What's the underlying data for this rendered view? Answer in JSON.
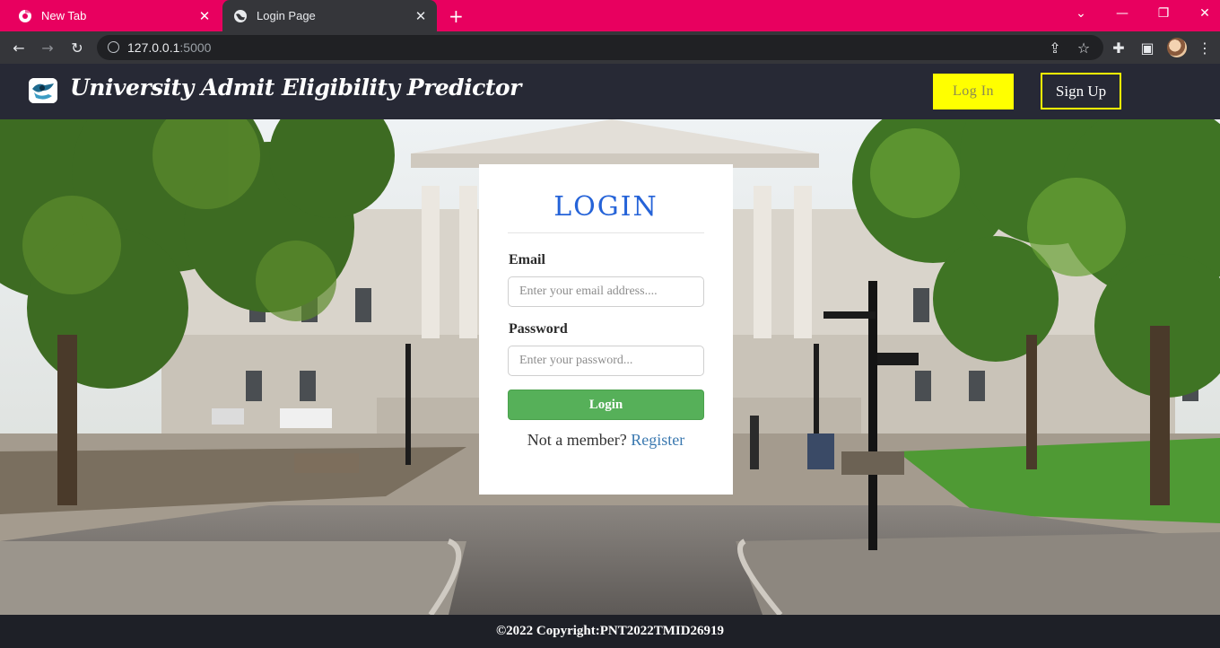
{
  "browser": {
    "tabs": [
      {
        "title": "New Tab",
        "active": false
      },
      {
        "title": "Login Page",
        "active": true
      }
    ],
    "url_host": "127.0.0.1",
    "url_port": ":5000",
    "accent": "#e8005f"
  },
  "site": {
    "brand": "University Admit Eligibility Predictor",
    "nav": {
      "login_label": "Log In",
      "signup_label": "Sign Up"
    }
  },
  "login_form": {
    "title": "LOGIN",
    "email_label": "Email",
    "email_placeholder": "Enter your email address....",
    "password_label": "Password",
    "password_placeholder": "Enter your password...",
    "submit_label": "Login",
    "member_text": "Not a member?",
    "register_link": "Register"
  },
  "footer": {
    "text": "©2022 Copyright:PNT2022TMID26919"
  },
  "colors": {
    "header_bg": "#272935",
    "highlight_yellow": "#ffff00",
    "login_button": "#56b059",
    "title_blue": "#2563d8"
  }
}
